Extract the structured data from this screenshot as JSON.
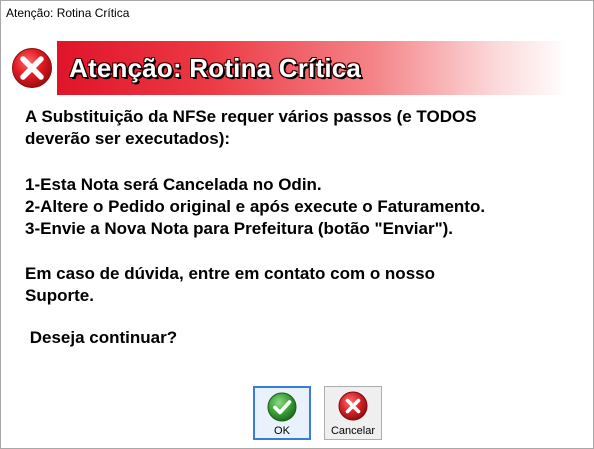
{
  "window": {
    "title": "Atenção: Rotina Crítica"
  },
  "banner": {
    "title": "Atenção: Rotina Crítica",
    "icon": "error-x-icon"
  },
  "message": {
    "intro_line1": "A Substituição da NFSe requer vários passos (e TODOS",
    "intro_line2": "deverão ser executados):",
    "step1": "1-Esta Nota será Cancelada no Odin.",
    "step2": "2-Altere o Pedido original e após execute o Faturamento.",
    "step3": "3-Envie a Nova Nota para Prefeitura (botão \"Enviar\").",
    "help_line1": "Em caso de dúvida, entre em contato com o nosso",
    "help_line2": "Suporte.",
    "question": " Deseja continuar?"
  },
  "buttons": {
    "ok_label": "OK",
    "ok_icon": "checkmark-icon",
    "cancel_label": "Cancelar",
    "cancel_icon": "cancel-x-icon"
  },
  "colors": {
    "banner_red": "#e0142a",
    "ok_green": "#3fa53a",
    "cancel_red": "#d8232a"
  }
}
